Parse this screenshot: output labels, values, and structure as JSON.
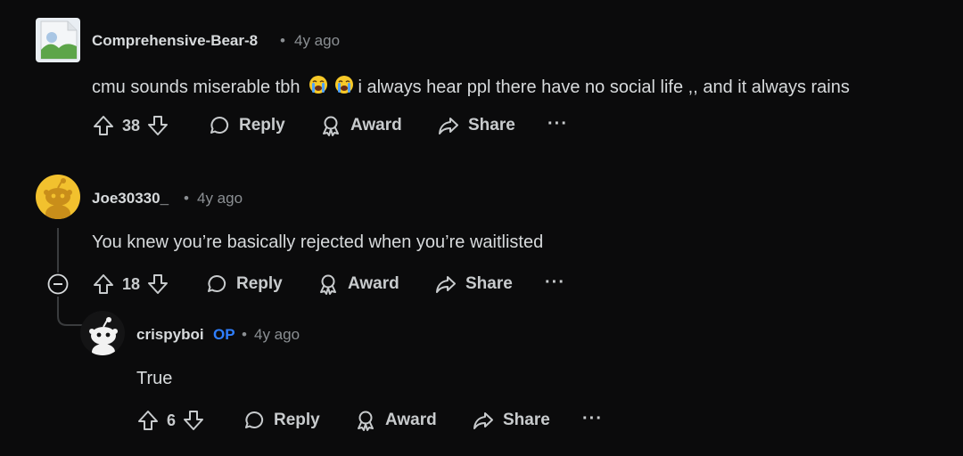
{
  "comments": [
    {
      "username": "Comprehensive-Bear-8",
      "time": "4y ago",
      "separator": "•",
      "text_before": "cmu sounds miserable tbh",
      "emojis": [
        "loudly-crying-face",
        "loudly-crying-face"
      ],
      "text_after": "i always hear ppl there have no social life ,, and it always rains",
      "votes": "38",
      "reply_label": "Reply",
      "award_label": "Award",
      "share_label": "Share",
      "more_label": "···"
    },
    {
      "username": "Joe30330_",
      "time": "4y ago",
      "separator": "•",
      "text": "You knew you’re basically rejected when you’re waitlisted",
      "votes": "18",
      "reply_label": "Reply",
      "award_label": "Award",
      "share_label": "Share",
      "more_label": "···",
      "collapse_icon": "minus-circle-icon"
    },
    {
      "username": "crispyboi",
      "op_badge": "OP",
      "time": "4y ago",
      "separator": "•",
      "text": "True",
      "votes": "6",
      "reply_label": "Reply",
      "award_label": "Award",
      "share_label": "Share",
      "more_label": "···"
    }
  ],
  "colors": {
    "background": "#0b0b0c",
    "text": "#d7dadc",
    "muted": "#8b8f93",
    "op_badge": "#2f7fff",
    "avatar_yellow": "#f2c12e"
  }
}
